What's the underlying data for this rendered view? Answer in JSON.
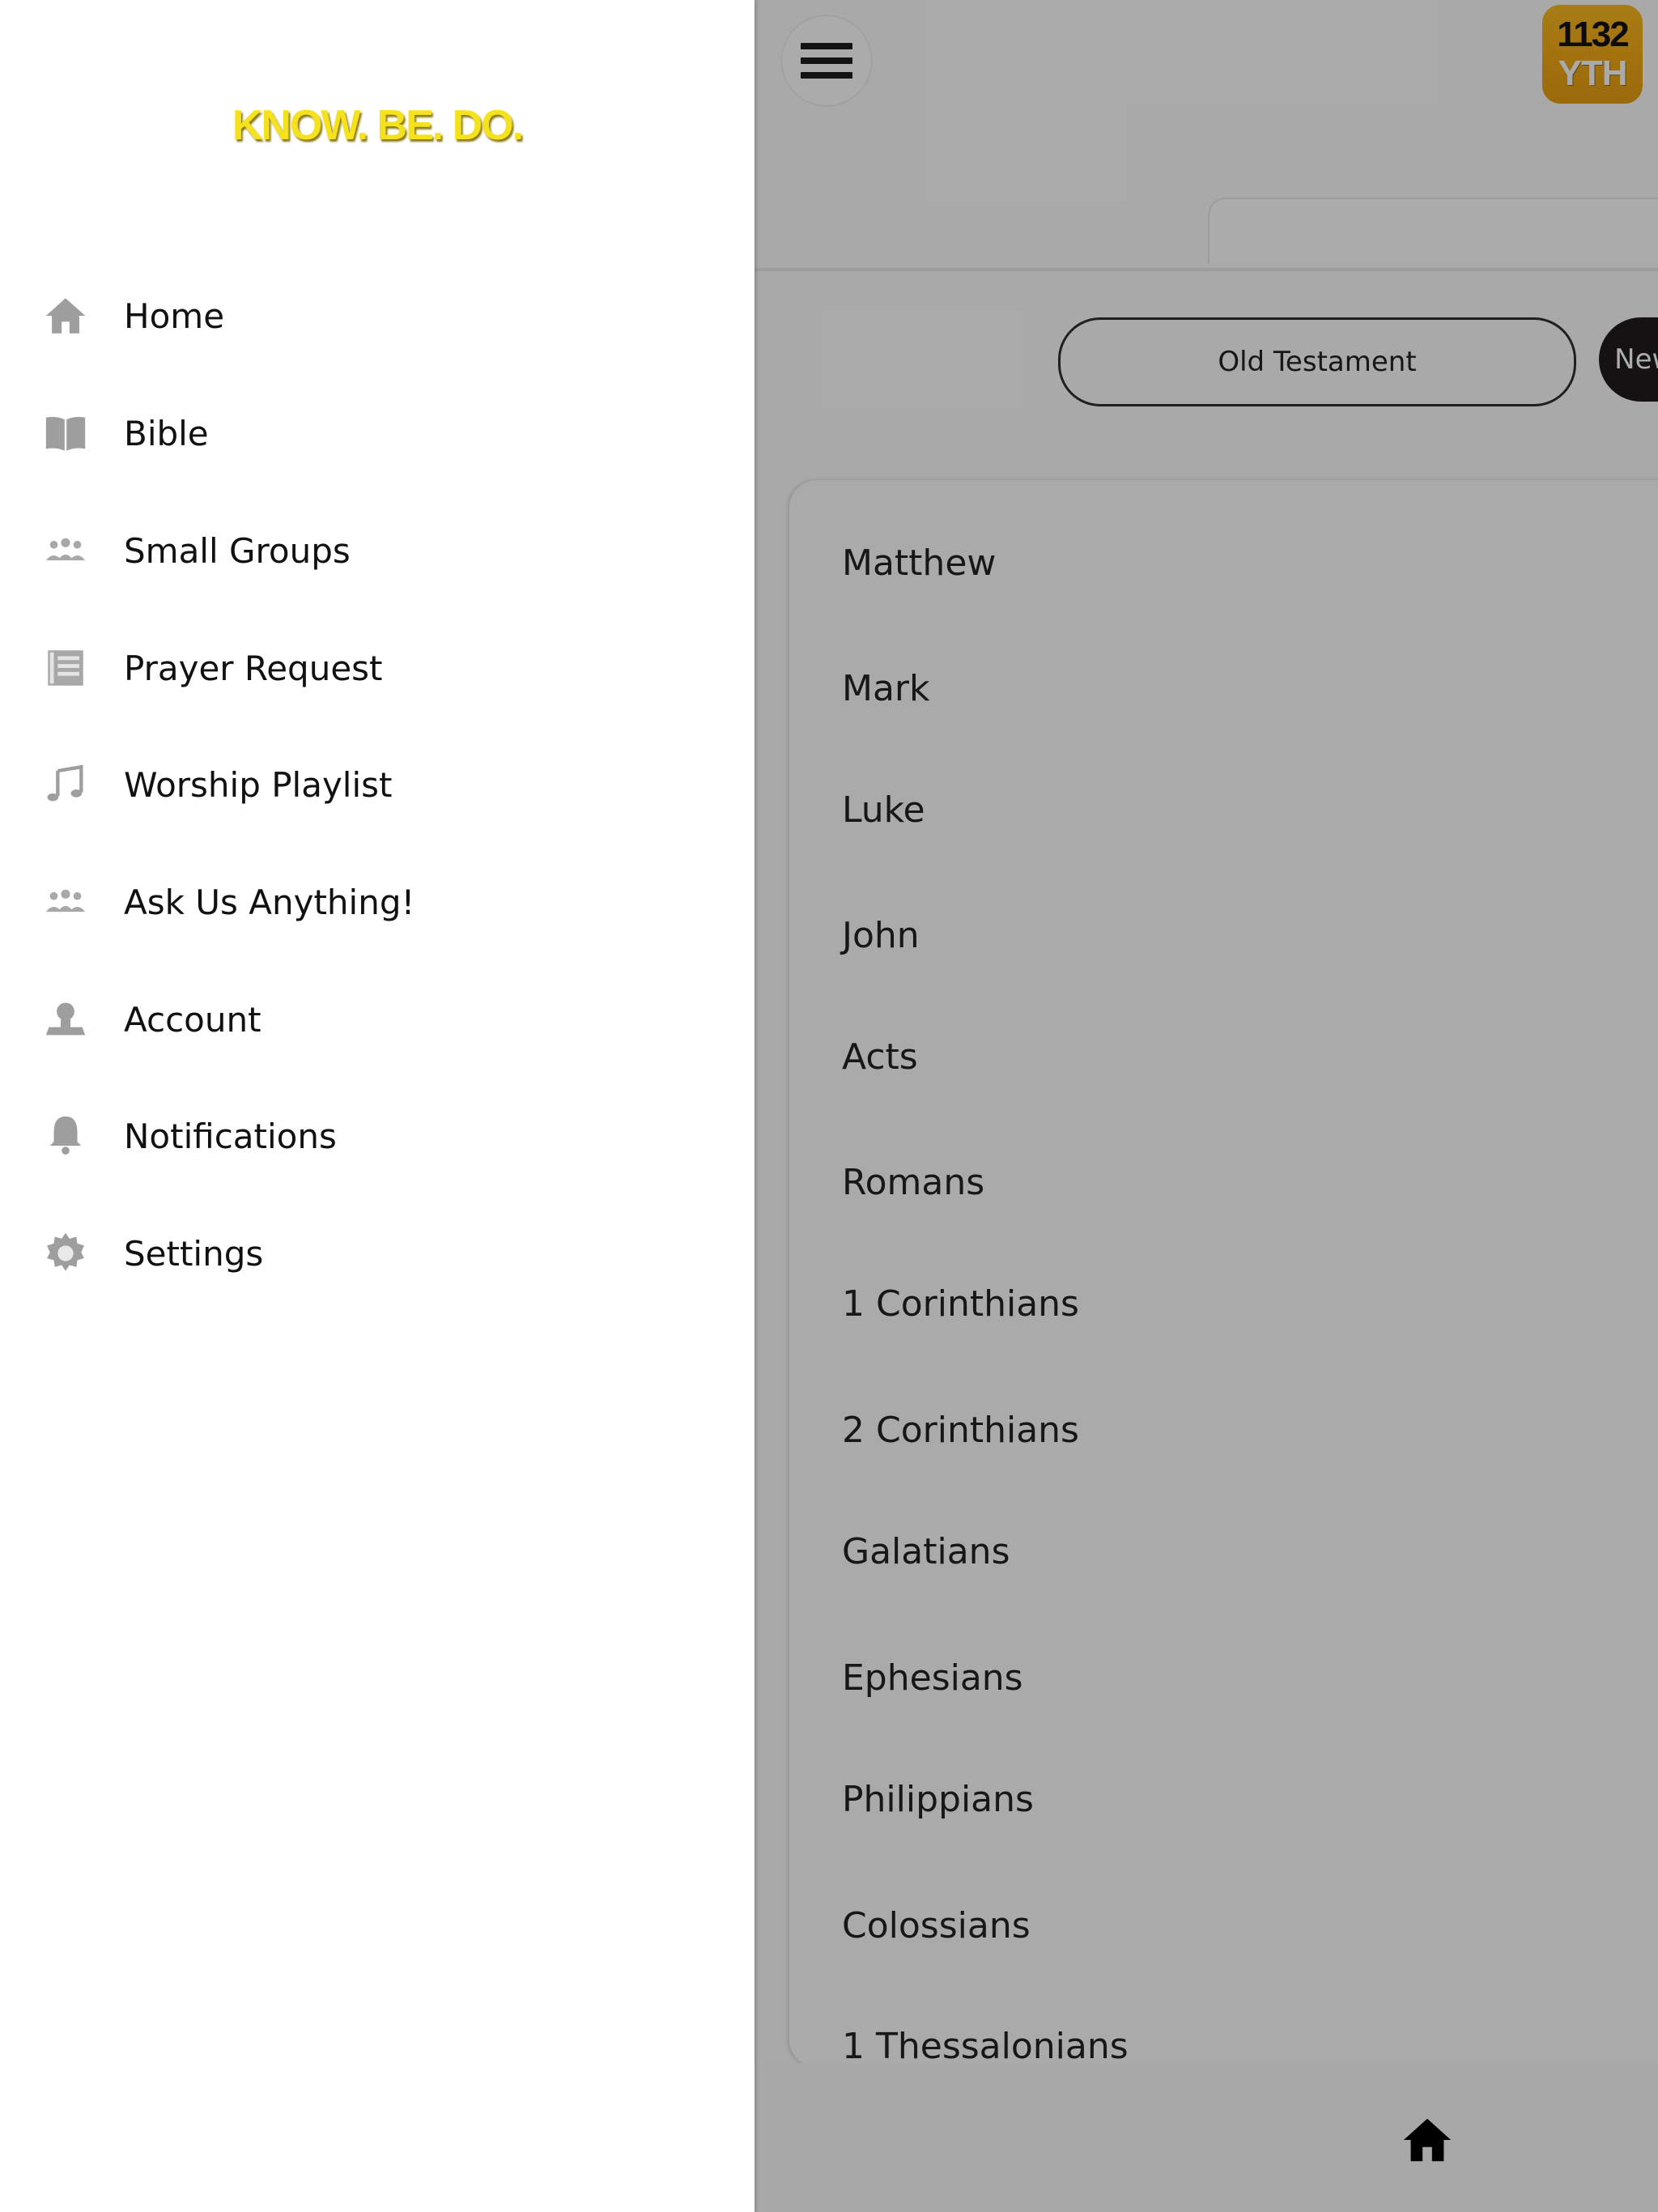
{
  "drawer": {
    "brand_tagline": "KNOW. BE. DO.",
    "menu": [
      {
        "label": "Home",
        "icon": "home-icon"
      },
      {
        "label": "Bible",
        "icon": "book-icon"
      },
      {
        "label": "Small Groups",
        "icon": "group-icon"
      },
      {
        "label": "Prayer Request",
        "icon": "document-icon"
      },
      {
        "label": "Worship Playlist",
        "icon": "music-note-icon"
      },
      {
        "label": "Ask Us Anything!",
        "icon": "group-icon"
      },
      {
        "label": "Account",
        "icon": "person-icon"
      },
      {
        "label": "Notifications",
        "icon": "bell-icon"
      },
      {
        "label": "Settings",
        "icon": "gear-icon"
      }
    ]
  },
  "header": {
    "badge_line1": "1132",
    "badge_line2": "YTH"
  },
  "testament_toggle": {
    "old_label": "Old Testament",
    "new_label": "New Testament",
    "selected": "New Testament"
  },
  "books": [
    "Matthew",
    "Mark",
    "Luke",
    "John",
    "Acts",
    "Romans",
    "1 Corinthians",
    "2 Corinthians",
    "Galatians",
    "Ephesians",
    "Philippians",
    "Colossians",
    "1 Thessalonians"
  ],
  "colors": {
    "brand_yellow": "#f6e21c",
    "badge_orange": "#f0a816",
    "scrim": "rgba(0,0,0,0.32)"
  }
}
